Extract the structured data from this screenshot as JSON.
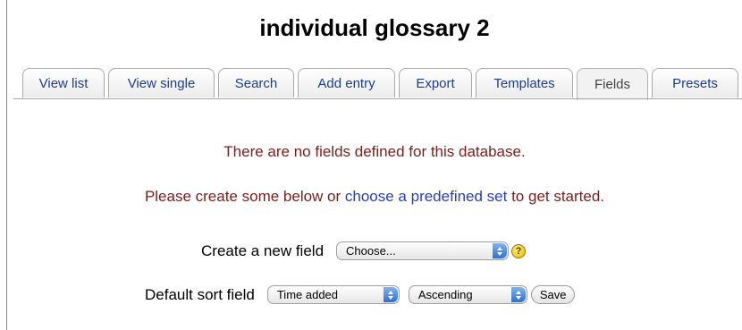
{
  "page": {
    "title": "individual glossary 2"
  },
  "tabs": [
    {
      "label": "View list",
      "active": false
    },
    {
      "label": "View single",
      "active": false
    },
    {
      "label": "Search",
      "active": false
    },
    {
      "label": "Add entry",
      "active": false
    },
    {
      "label": "Export",
      "active": false
    },
    {
      "label": "Templates",
      "active": false
    },
    {
      "label": "Fields",
      "active": true
    },
    {
      "label": "Presets",
      "active": false
    }
  ],
  "messages": {
    "no_fields": "There are no fields defined for this database.",
    "create_prefix": "Please create some below or ",
    "create_link": "choose a predefined set",
    "create_suffix": " to get started."
  },
  "create_field": {
    "label": "Create a new field",
    "select_value": "Choose...",
    "help_icon": "question-mark-icon"
  },
  "sort": {
    "label": "Default sort field",
    "field_value": "Time added",
    "order_value": "Ascending",
    "save_label": "Save"
  },
  "colors": {
    "message": "#7a1d1d",
    "link": "#2b3fb8",
    "tab_text": "#1a3c94",
    "select_arrow": "#2f6fd0"
  }
}
